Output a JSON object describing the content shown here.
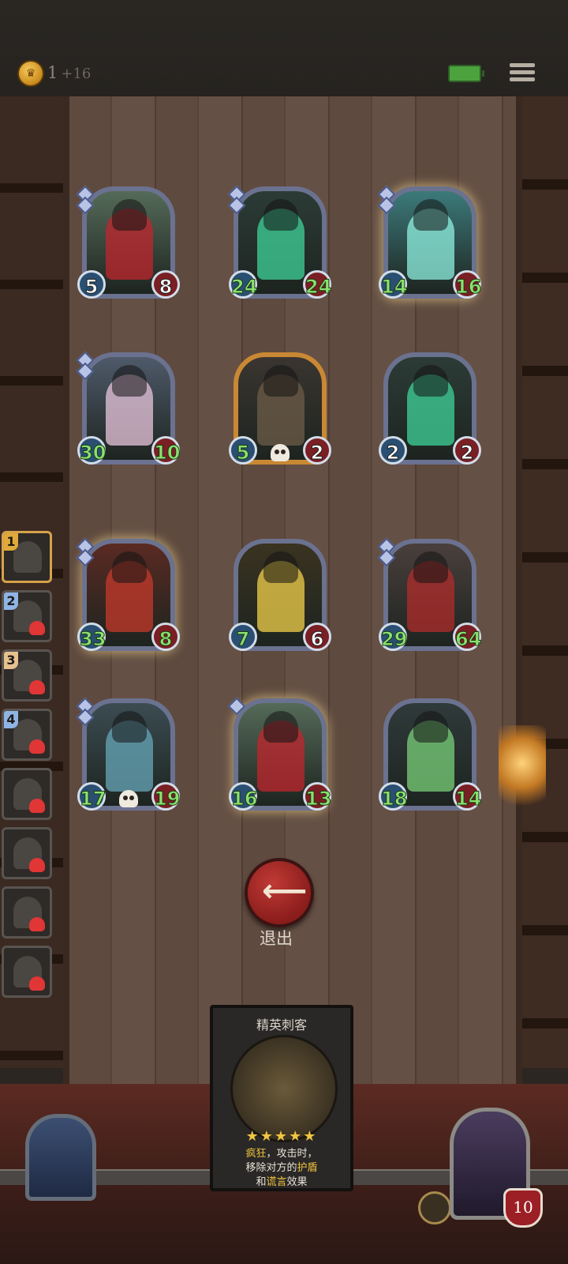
{
  "top_bar": {
    "coin_icon": "crown-coin-icon",
    "coins": "1",
    "coins_plus": "+16",
    "battery_icon": "battery-icon",
    "menu_icon": "menu-icon"
  },
  "board": {
    "cards": [
      {
        "atk": "5",
        "hp": "8",
        "atk_color": "white",
        "hp_color": "white",
        "art": "hooded-elder-rose",
        "frame": "silver",
        "gems": 2
      },
      {
        "atk": "24",
        "hp": "24",
        "atk_color": "green",
        "hp_color": "green",
        "art": "reaper-boat",
        "frame": "silver",
        "gems": 2
      },
      {
        "atk": "14",
        "hp": "16",
        "atk_color": "green",
        "hp_color": "green",
        "art": "ghost-warrior",
        "frame": "silver-glow",
        "gems": 2
      },
      {
        "atk": "30",
        "hp": "10",
        "atk_color": "green",
        "hp_color": "green",
        "art": "masked-dancer",
        "frame": "silver",
        "gems": 2
      },
      {
        "atk": "5",
        "hp": "2",
        "atk_color": "green",
        "hp_color": "white",
        "art": "tentacle-chest",
        "frame": "gold",
        "gems": 0,
        "skull": true
      },
      {
        "atk": "2",
        "hp": "2",
        "atk_color": "white",
        "hp_color": "white",
        "art": "reaper-boat",
        "frame": "silver",
        "gems": 0
      },
      {
        "atk": "33",
        "hp": "8",
        "atk_color": "green",
        "hp_color": "green",
        "art": "red-hood-assassin",
        "frame": "silver-glow",
        "gems": 2
      },
      {
        "atk": "7",
        "hp": "6",
        "atk_color": "green",
        "hp_color": "white",
        "art": "golden-priestess",
        "frame": "silver",
        "gems": 0
      },
      {
        "atk": "29",
        "hp": "64",
        "atk_color": "green",
        "hp_color": "green",
        "art": "armored-knight",
        "frame": "silver",
        "gems": 2
      },
      {
        "atk": "17",
        "hp": "19",
        "atk_color": "green",
        "hp_color": "green",
        "art": "stitched-rabbit",
        "frame": "silver",
        "gems": 2,
        "skull": true
      },
      {
        "atk": "16",
        "hp": "13",
        "atk_color": "green",
        "hp_color": "green",
        "art": "hooded-elder-rose",
        "frame": "silver-glow",
        "gems": 1
      },
      {
        "atk": "18",
        "hp": "14",
        "atk_color": "green",
        "hp_color": "green",
        "art": "skull-shaman",
        "frame": "silver",
        "gems": 0
      }
    ]
  },
  "exit": {
    "icon": "arrow-left-icon",
    "label": "退出"
  },
  "queue": {
    "items": [
      {
        "num": "1",
        "badge_color": "#e0a93a",
        "dead": false
      },
      {
        "num": "2",
        "badge_color": "#8fb4e6",
        "dead": true
      },
      {
        "num": "3",
        "badge_color": "#e6c08f",
        "dead": true
      },
      {
        "num": "4",
        "badge_color": "#8fb4e6",
        "dead": true
      },
      {
        "num": "",
        "dead": true
      },
      {
        "num": "",
        "dead": true
      },
      {
        "num": "",
        "dead": true
      },
      {
        "num": "",
        "dead": true
      }
    ]
  },
  "selected_card": {
    "title": "精英刺客",
    "stars": "★★★★★",
    "desc_1_highlight": "疯狂",
    "desc_1_rest": "，攻击时，",
    "desc_2_pre": "移除对方的",
    "desc_2_highlight": "护盾",
    "desc_3_pre": "和",
    "desc_3_highlight": "谎言",
    "desc_3_rest": "效果"
  },
  "player": {
    "hp": "10",
    "hp_icon": "heart-shield-icon",
    "badge_icon": "gold-fist-icon"
  }
}
